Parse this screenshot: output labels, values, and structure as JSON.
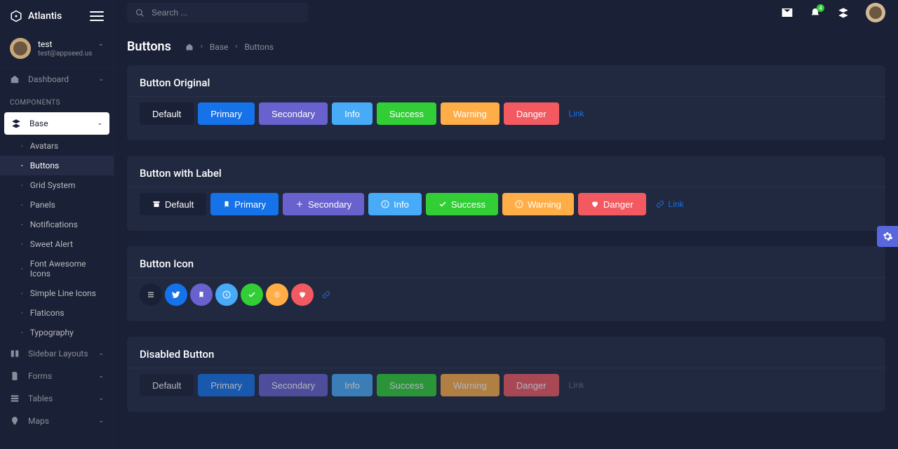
{
  "brand": {
    "name": "Atlantis"
  },
  "user": {
    "name": "test",
    "email": "test@appseed.us"
  },
  "search": {
    "placeholder": "Search ..."
  },
  "notifications": {
    "count": "4"
  },
  "nav": {
    "dashboard": "Dashboard",
    "section_components": "COMPONENTS",
    "base": "Base",
    "base_children": {
      "avatars": "Avatars",
      "buttons": "Buttons",
      "grid": "Grid System",
      "panels": "Panels",
      "notifications": "Notifications",
      "sweetalert": "Sweet Alert",
      "fontawesome": "Font Awesome Icons",
      "simpleline": "Simple Line Icons",
      "flaticons": "Flaticons",
      "typography": "Typography"
    },
    "sidebar_layouts": "Sidebar Layouts",
    "forms": "Forms",
    "tables": "Tables",
    "maps": "Maps"
  },
  "page": {
    "title": "Buttons",
    "breadcrumb": {
      "base": "Base",
      "current": "Buttons"
    }
  },
  "cards": {
    "original": {
      "title": "Button Original",
      "buttons": {
        "default": "Default",
        "primary": "Primary",
        "secondary": "Secondary",
        "info": "Info",
        "success": "Success",
        "warning": "Warning",
        "danger": "Danger",
        "link": "Link"
      }
    },
    "withlabel": {
      "title": "Button with Label",
      "buttons": {
        "default": "Default",
        "primary": "Primary",
        "secondary": "Secondary",
        "info": "Info",
        "success": "Success",
        "warning": "Warning",
        "danger": "Danger",
        "link": "Link"
      }
    },
    "icon": {
      "title": "Button Icon"
    },
    "disabled": {
      "title": "Disabled Button",
      "buttons": {
        "default": "Default",
        "primary": "Primary",
        "secondary": "Secondary",
        "info": "Info",
        "success": "Success",
        "warning": "Warning",
        "danger": "Danger",
        "link": "Link"
      }
    }
  }
}
